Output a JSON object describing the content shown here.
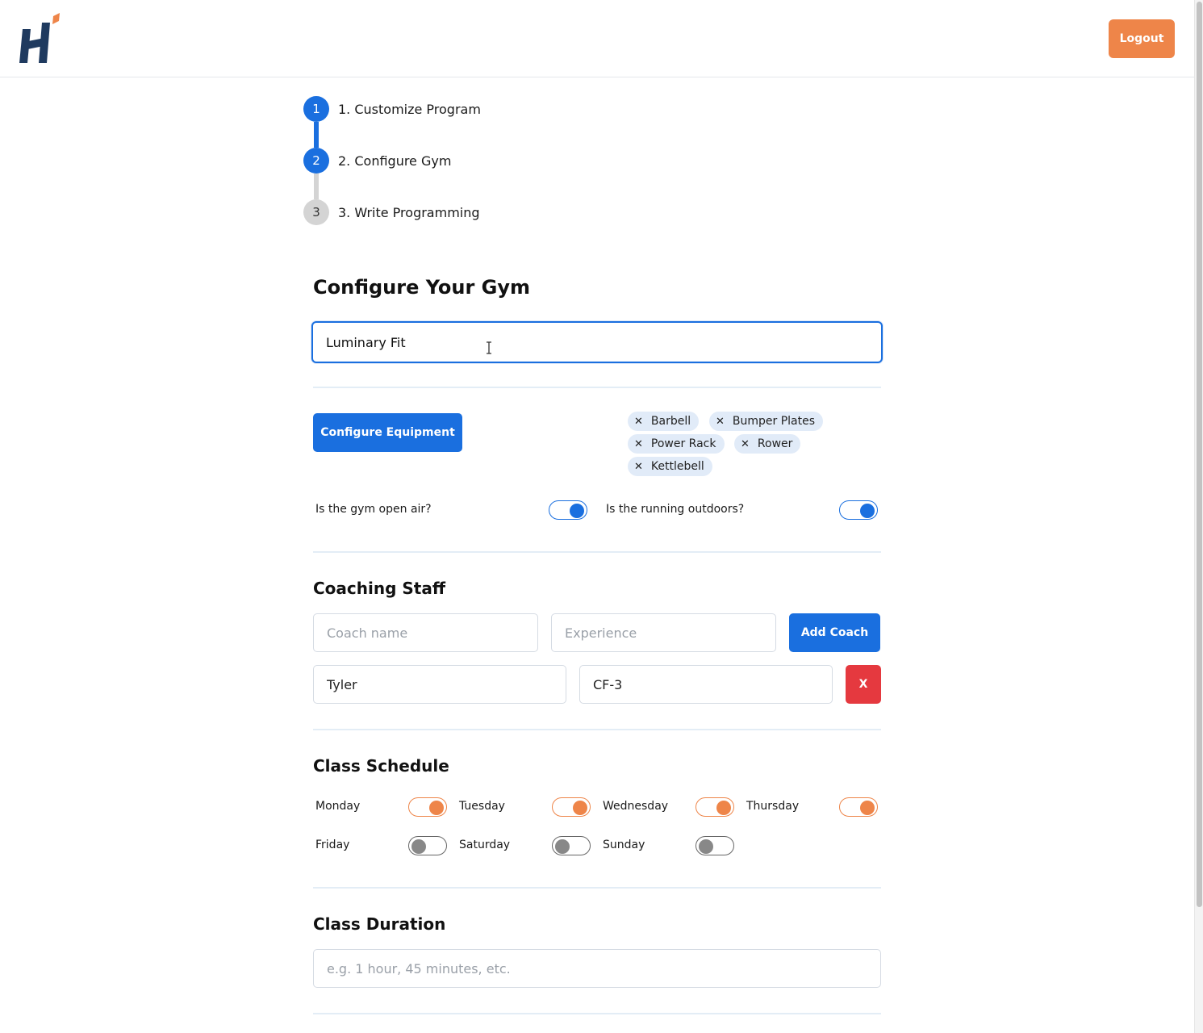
{
  "header": {
    "logout_label": "Logout"
  },
  "stepper": {
    "steps": [
      {
        "number": "1",
        "label": "1. Customize Program",
        "state": "active"
      },
      {
        "number": "2",
        "label": "2. Configure Gym",
        "state": "active"
      },
      {
        "number": "3",
        "label": "3. Write Programming",
        "state": "inactive"
      }
    ]
  },
  "form": {
    "title": "Configure Your Gym",
    "gym_name_value": "Luminary Fit",
    "equipment": {
      "button_label": "Configure Equipment",
      "chips": [
        "Barbell",
        "Bumper Plates",
        "Power Rack",
        "Rower",
        "Kettlebell"
      ]
    },
    "toggles": {
      "open_air_label": "Is the gym open air?",
      "open_air_on": true,
      "running_outdoors_label": "Is the running outdoors?",
      "running_outdoors_on": true
    },
    "coaching": {
      "title": "Coaching Staff",
      "name_placeholder": "Coach name",
      "experience_placeholder": "Experience",
      "add_label": "Add Coach",
      "coaches": [
        {
          "name": "Tyler",
          "experience": "CF-3",
          "remove_label": "X"
        }
      ]
    },
    "schedule": {
      "title": "Class Schedule",
      "days": [
        {
          "label": "Monday",
          "on": true
        },
        {
          "label": "Tuesday",
          "on": true
        },
        {
          "label": "Wednesday",
          "on": true
        },
        {
          "label": "Thursday",
          "on": true
        },
        {
          "label": "Friday",
          "on": false
        },
        {
          "label": "Saturday",
          "on": false
        },
        {
          "label": "Sunday",
          "on": false
        }
      ]
    },
    "duration": {
      "title": "Class Duration",
      "placeholder": "e.g. 1 hour, 45 minutes, etc."
    }
  },
  "colors": {
    "primary": "#1a6fdf",
    "accent": "#ee8549",
    "danger": "#e5393f"
  }
}
